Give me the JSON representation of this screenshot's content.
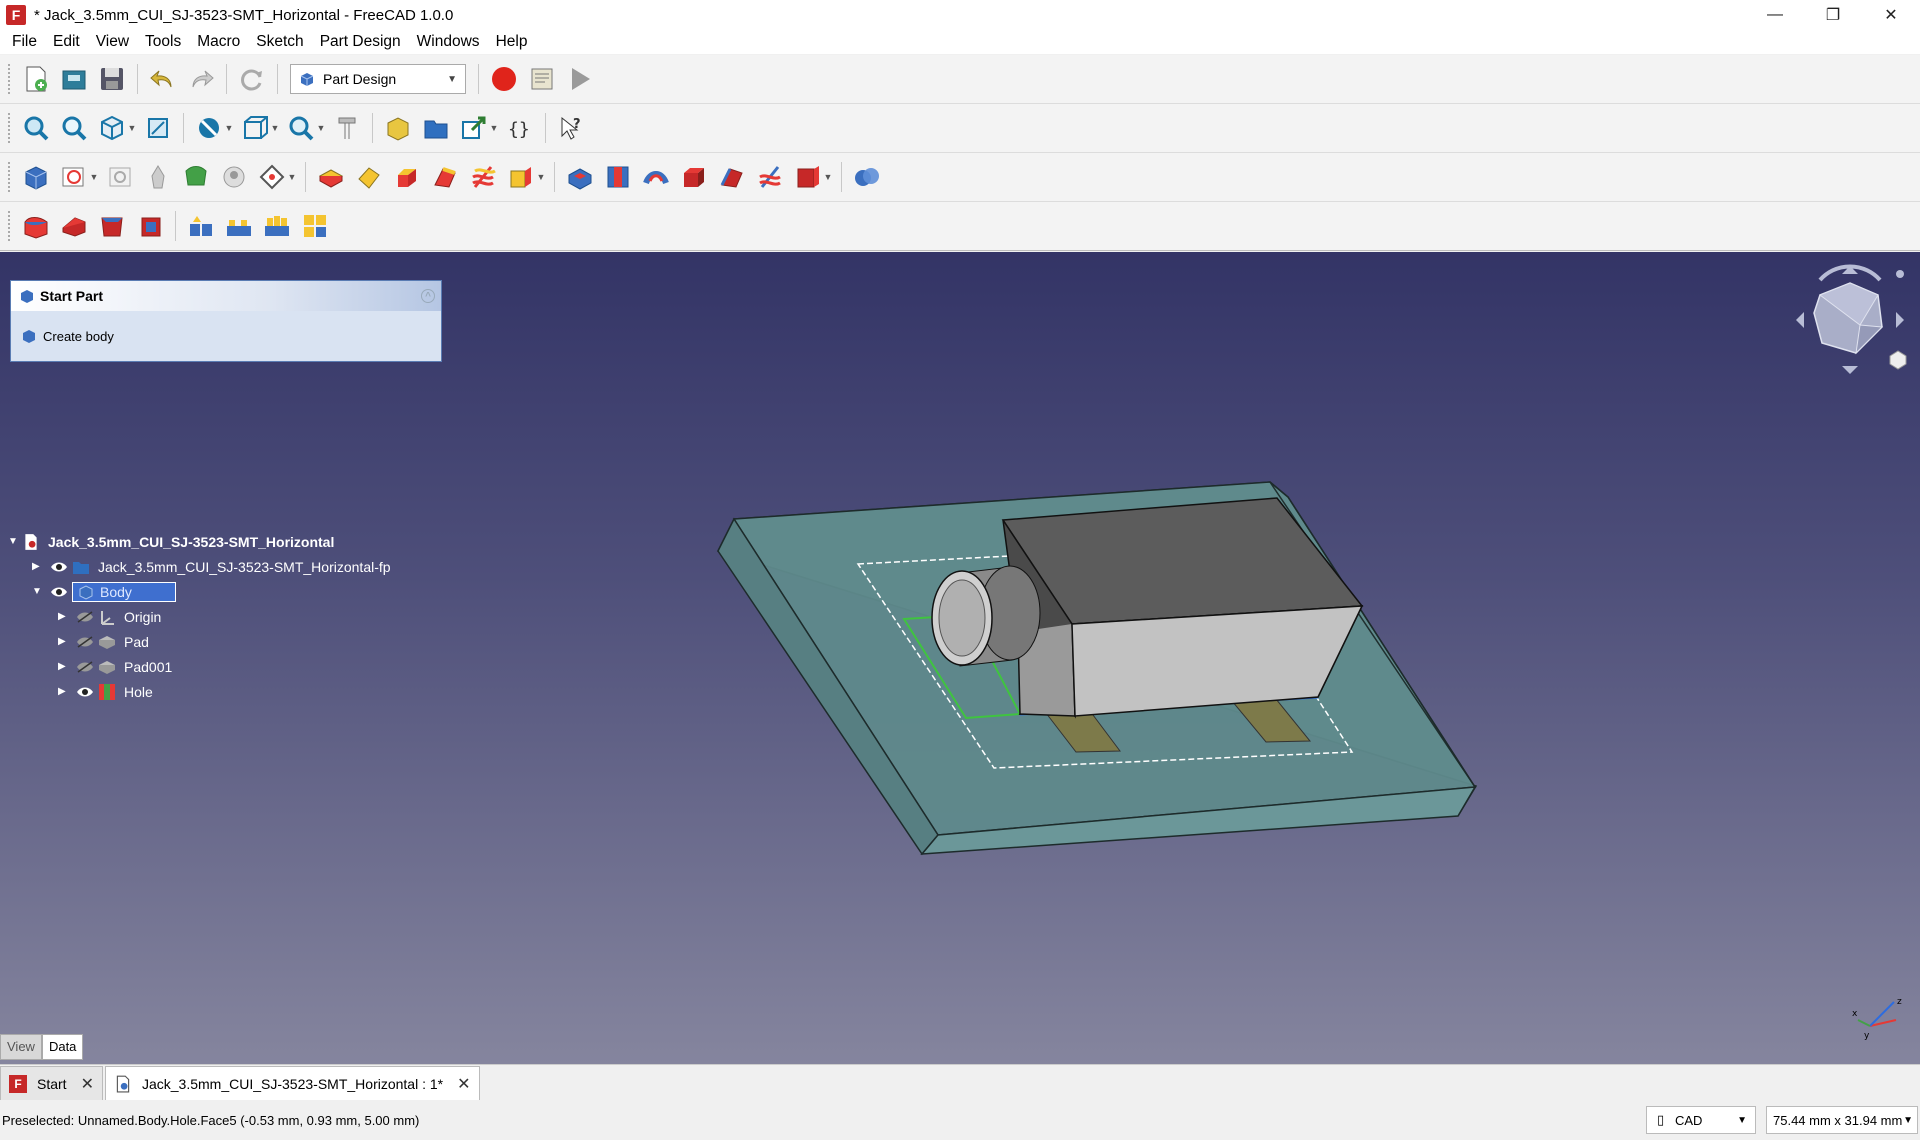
{
  "window": {
    "title": "* Jack_3.5mm_CUI_SJ-3523-SMT_Horizontal - FreeCAD 1.0.0",
    "app_icon_letter": "F",
    "minimize": "—",
    "maximize": "❐",
    "close": "✕"
  },
  "menu": [
    "File",
    "Edit",
    "View",
    "Tools",
    "Macro",
    "Sketch",
    "Part Design",
    "Windows",
    "Help"
  ],
  "workbench": {
    "selected": "Part Design"
  },
  "task_panel": {
    "title": "Start Part",
    "action": "Create body"
  },
  "tree": {
    "document": "Jack_3.5mm_CUI_SJ-3523-SMT_Horizontal",
    "footprint": "Jack_3.5mm_CUI_SJ-3523-SMT_Horizontal-fp",
    "body": "Body",
    "children": [
      "Origin",
      "Pad",
      "Pad001",
      "Hole"
    ]
  },
  "view_tabs": [
    "View",
    "Data"
  ],
  "doc_tabs": [
    {
      "label": "Start",
      "close": "✕"
    },
    {
      "label": "Jack_3.5mm_CUI_SJ-3523-SMT_Horizontal : 1*",
      "close": "✕"
    }
  ],
  "status": {
    "preselected": "Preselected: Unnamed.Body.Hole.Face5 (-0.53 mm, 0.93 mm, 5.00 mm)",
    "nav_style": "CAD",
    "dimensions": "75.44 mm x 31.94 mm"
  },
  "colors": {
    "viewport_top": "#333466",
    "viewport_bottom": "#85859e",
    "selection": "#3f6fcf",
    "record": "#e0241b"
  }
}
